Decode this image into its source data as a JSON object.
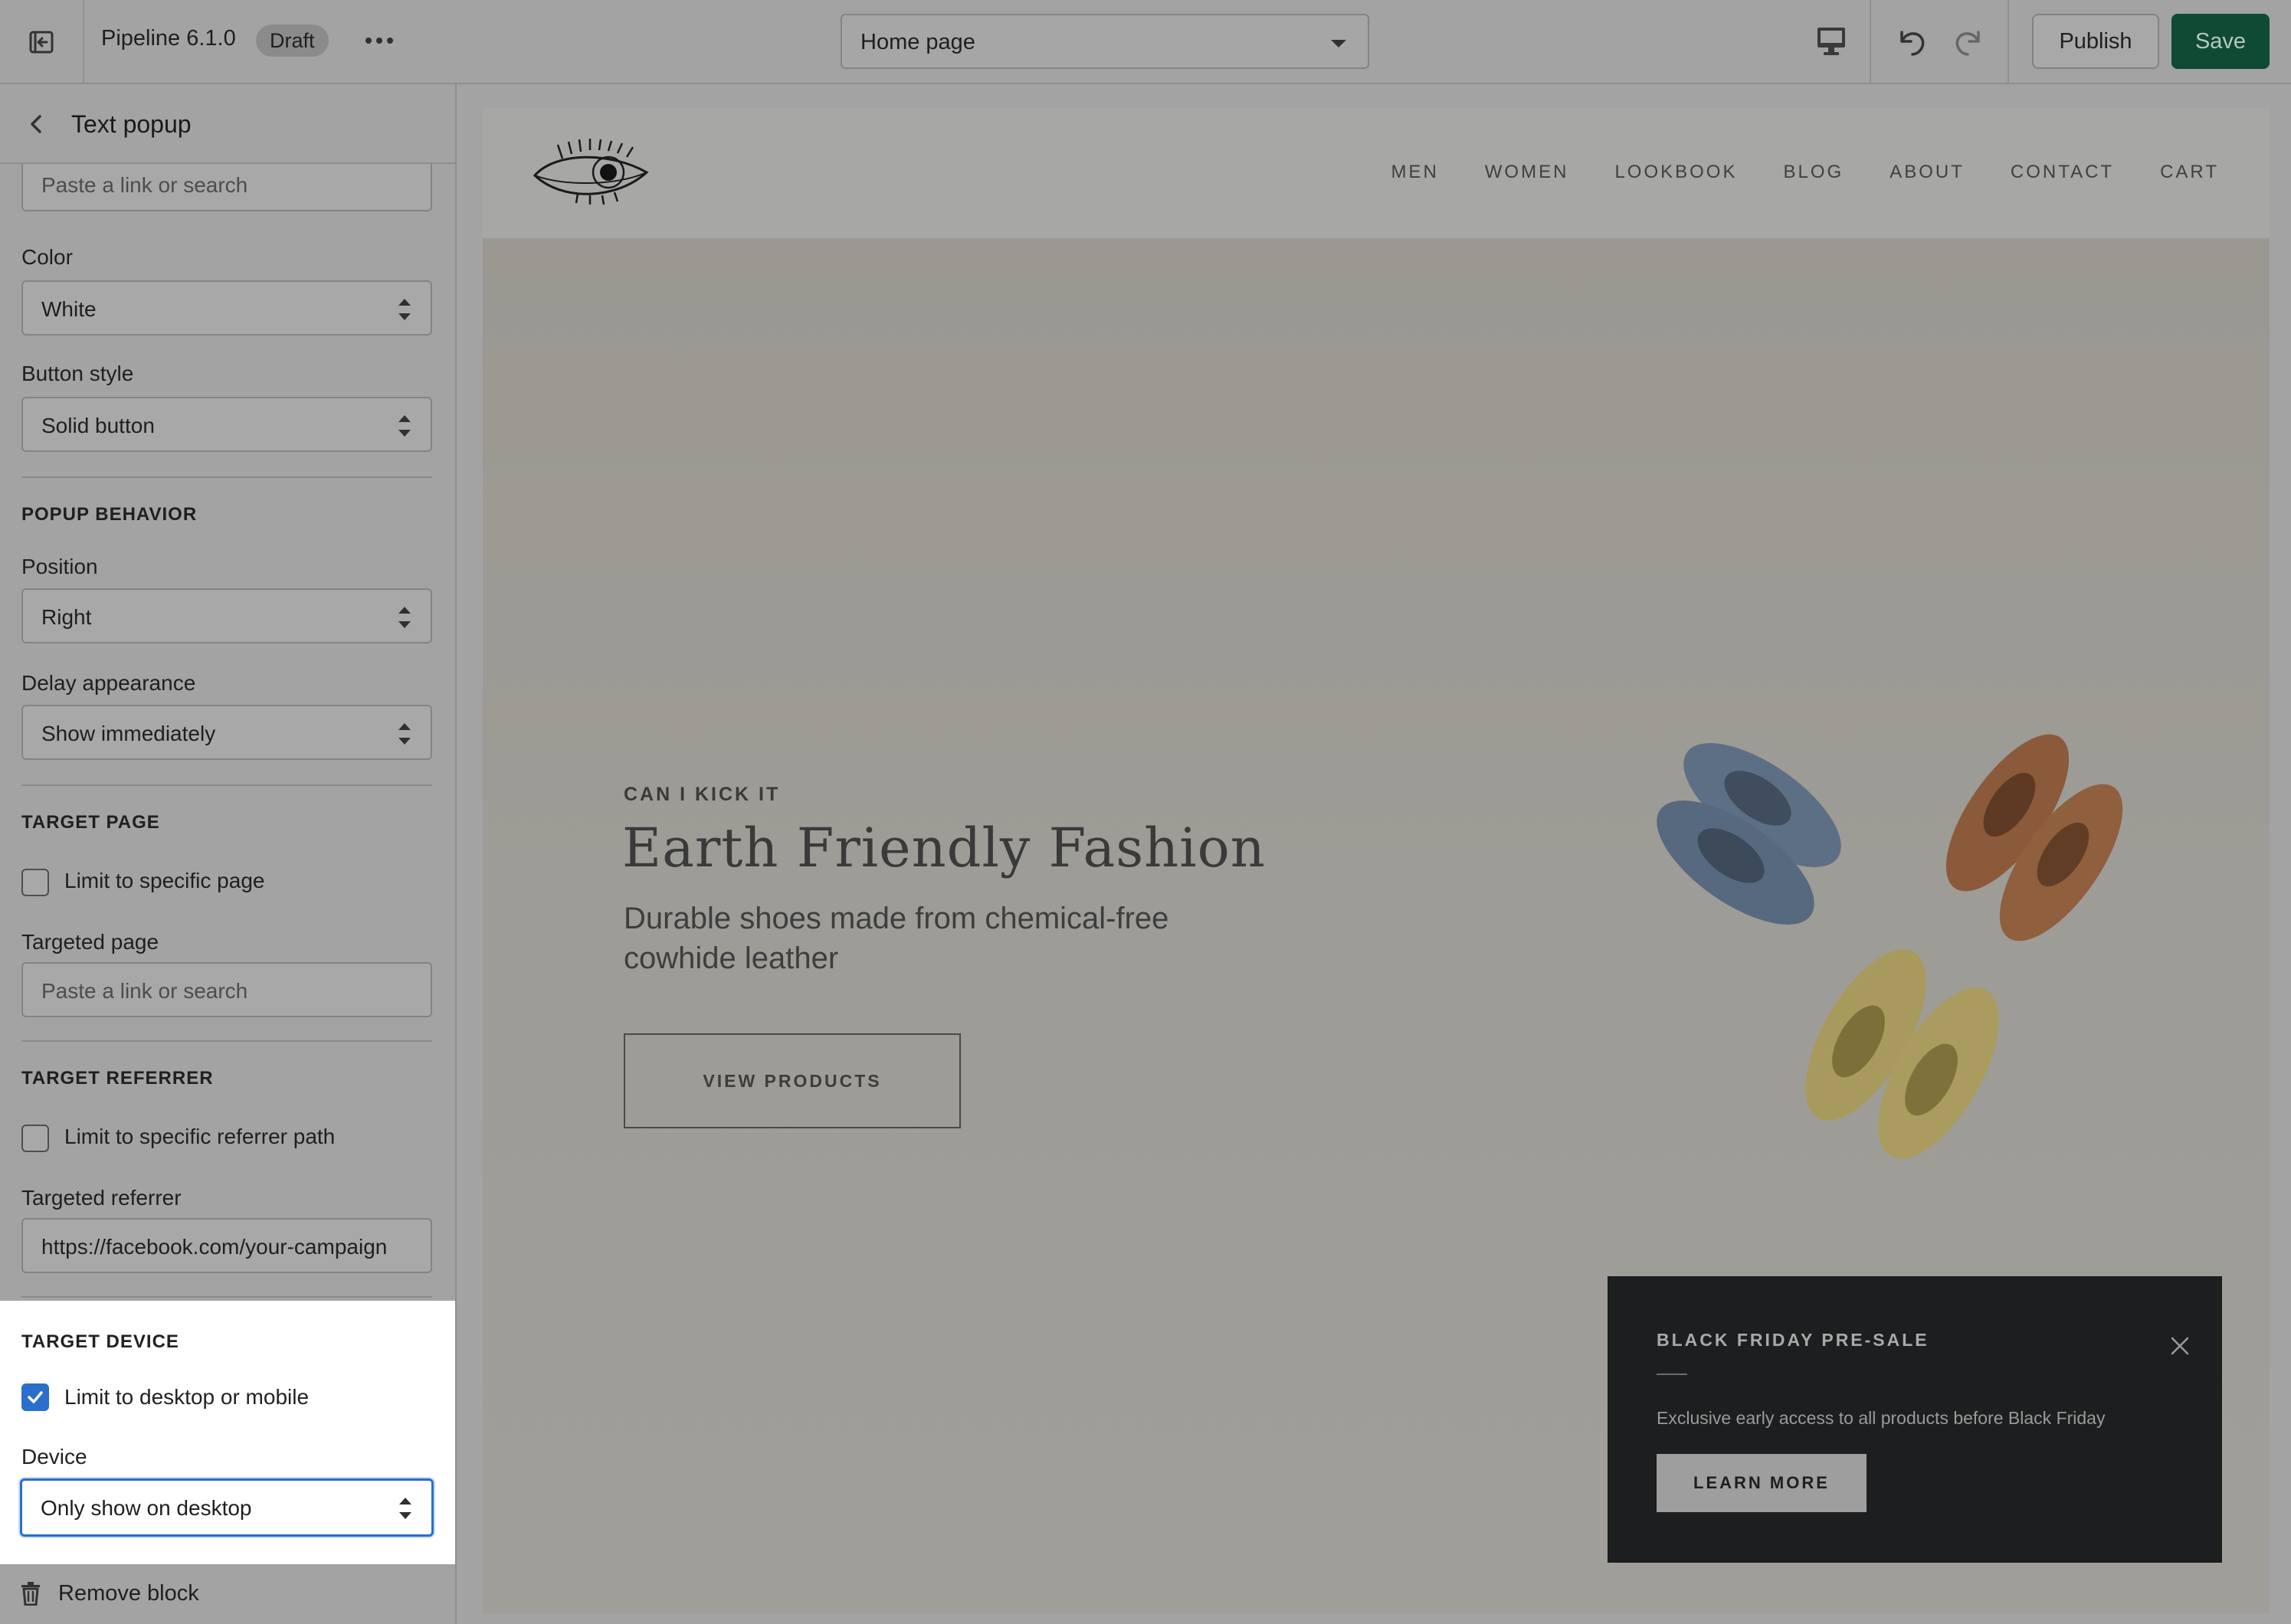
{
  "topbar": {
    "theme_name": "Pipeline 6.1.0",
    "theme_badge": "Draft",
    "page_select": "Home page",
    "publish_label": "Publish",
    "save_label": "Save",
    "icons": [
      "exit-icon",
      "more-icon",
      "desktop-icon",
      "undo-icon",
      "redo-icon",
      "chevron-down-icon"
    ]
  },
  "sidebar": {
    "title": "Text popup",
    "link_field": {
      "placeholder": "Paste a link or search"
    },
    "color": {
      "label": "Color",
      "value": "White"
    },
    "button_style": {
      "label": "Button style",
      "value": "Solid button"
    },
    "popup_behavior": {
      "title": "POPUP BEHAVIOR",
      "position": {
        "label": "Position",
        "value": "Right"
      },
      "delay": {
        "label": "Delay appearance",
        "value": "Show immediately"
      }
    },
    "target_page": {
      "title": "TARGET PAGE",
      "checkbox_label": "Limit to specific page",
      "checked": false,
      "field_label": "Targeted page",
      "field_placeholder": "Paste a link or search"
    },
    "target_referrer": {
      "title": "TARGET REFERRER",
      "checkbox_label": "Limit to specific referrer path",
      "checked": false,
      "field_label": "Targeted referrer",
      "field_value": "https://facebook.com/your-campaign"
    },
    "target_device": {
      "title": "TARGET DEVICE",
      "checkbox_label": "Limit to desktop or mobile",
      "checked": true,
      "field_label": "Device",
      "field_value": "Only show on desktop"
    },
    "remove_label": "Remove block"
  },
  "preview": {
    "nav": [
      "MEN",
      "WOMEN",
      "LOOKBOOK",
      "BLOG",
      "ABOUT",
      "CONTACT",
      "CART"
    ],
    "hero": {
      "eyebrow": "CAN I KICK IT",
      "headline": "Earth Friendly Fashion",
      "subhead": "Durable shoes made from chemical-free cowhide leather",
      "button": "VIEW PRODUCTS"
    },
    "popup": {
      "title": "BLACK FRIDAY PRE-SALE",
      "text": "Exclusive early access to all products before Black Friday",
      "button": "LEARN MORE"
    }
  },
  "colors": {
    "overlay_gray": "#a3a3a3",
    "save_green": "#0f4a35",
    "focus_blue": "#2c6ecb",
    "popup_dark": "#1d1e1f"
  }
}
